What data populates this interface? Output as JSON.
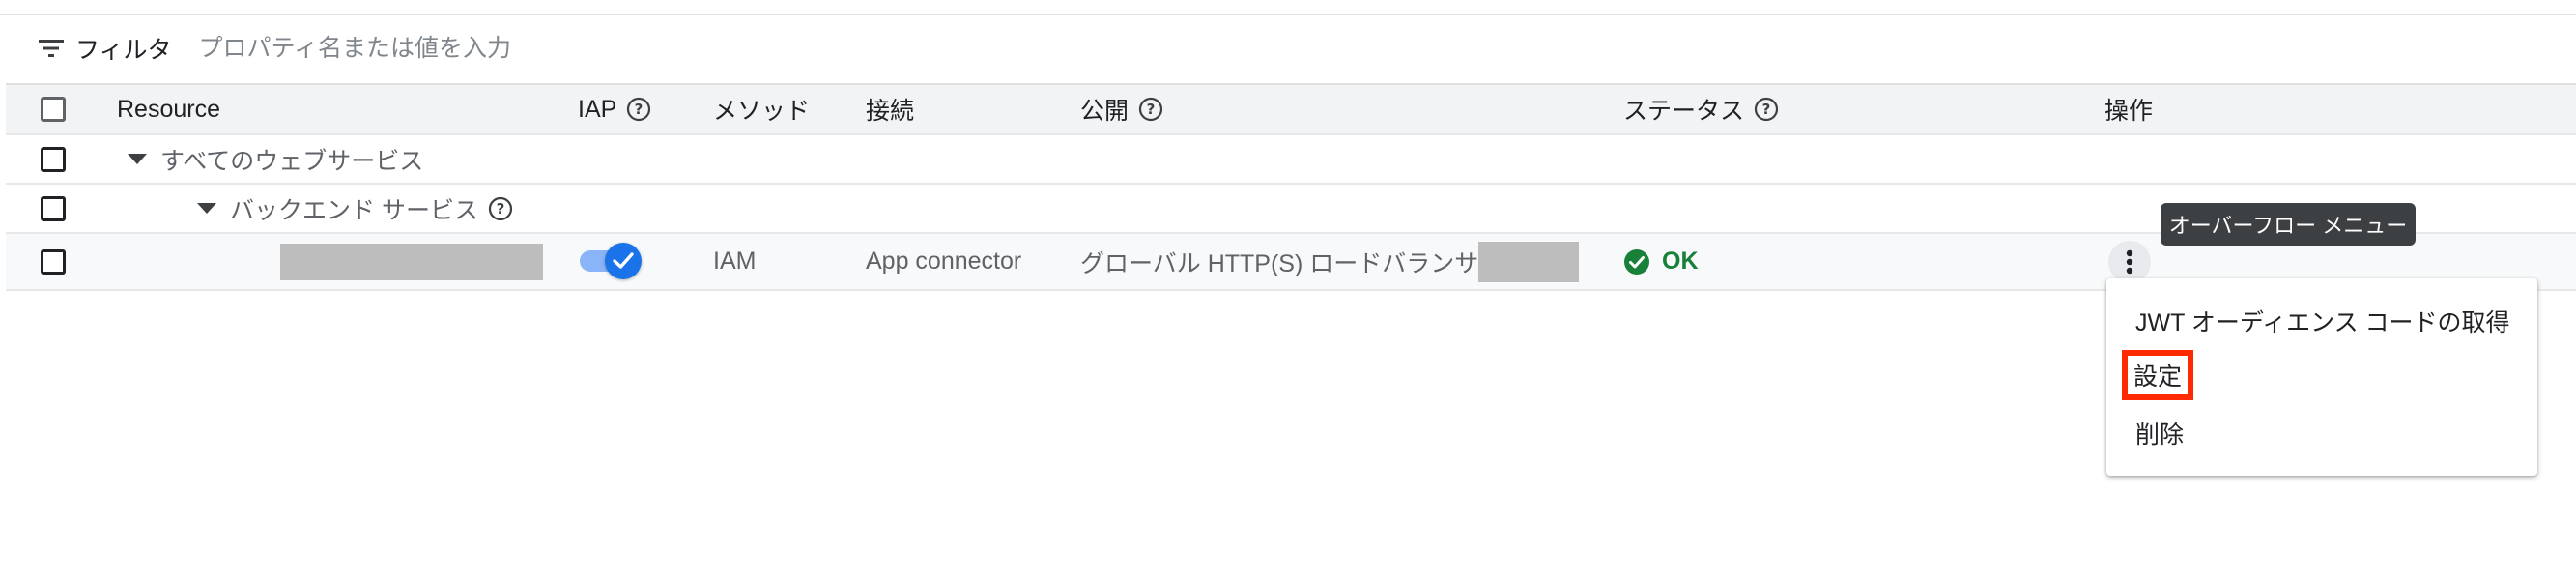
{
  "filter": {
    "label": "フィルタ",
    "placeholder": "プロパティ名または値を入力"
  },
  "table": {
    "headers": {
      "resource": "Resource",
      "iap": "IAP",
      "method": "メソッド",
      "connection": "接続",
      "published": "公開",
      "status": "ステータス",
      "actions": "操作"
    },
    "groups": {
      "all_web_services": "すべてのウェブサービス",
      "backend_services": "バックエンド サービス"
    },
    "row": {
      "iap_enabled": true,
      "method": "IAM",
      "connection": "App connector",
      "published": "グローバル HTTP(S) ロードバランサー",
      "status": "OK"
    }
  },
  "tooltip": "オーバーフロー メニュー",
  "menu": {
    "items": [
      "JWT オーディエンス コードの取得",
      "設定",
      "削除"
    ],
    "highlighted_item": "設定"
  },
  "colors": {
    "accent": "#1a73e8",
    "status_ok": "#188038",
    "highlight_box": "#ff2a00",
    "header_bg": "#f1f3f4"
  },
  "icons": {
    "filter": "filter-icon",
    "help": "help-circle-icon",
    "status": "check-circle-icon",
    "overflow": "more-vert-icon",
    "expand": "caret-down-icon"
  }
}
